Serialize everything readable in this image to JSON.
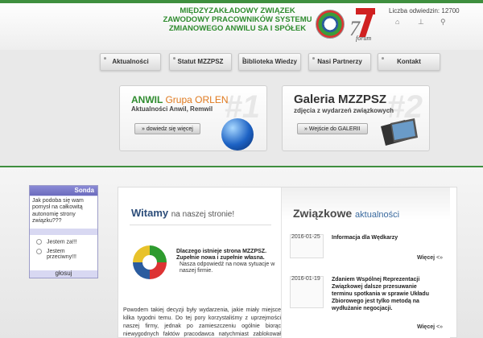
{
  "header": {
    "org_name": "MIĘDZYZAKŁADOWY ZWIĄZEK ZAWODOWY PRACOWNIKÓW SYSTEMU ZMIANOWEGO ANWILU SA I SPÓŁEK",
    "logo_text": "forum",
    "visits": "Liczba odwiedzin: 12700"
  },
  "nav": [
    "Aktualności",
    "Statut MZZPSZ",
    "Biblioteka Wiedzy",
    "Nasi Partnerzy",
    "Kontakt"
  ],
  "banner1": {
    "title_part1": "ANWIL",
    "title_part2": "Grupa ORLEN",
    "subtitle": "Aktualności Anwil, Remwil",
    "button": "» dowiedz się więcej",
    "watermark": "#1"
  },
  "banner2": {
    "title": "Galeria MZZPSZ",
    "subtitle": "zdjęcia z wydarzeń związkowych",
    "button": "» Wejście do GALERII",
    "watermark": "#2"
  },
  "sonda": {
    "title": "Sonda",
    "question": "Jak podoba się wam pomysł na całkowitą autonomię strony związku???",
    "options": [
      "Jestem za!!!",
      "Jestem przeciwny!!!"
    ],
    "vote": "głosuj"
  },
  "welcome": {
    "title_bold": "Witamy",
    "title_rest": "na naszej stronie!",
    "why_title": "Dlaczego istnieje strona MZZPSZ. Zupełnie nowa i zupełnie własna.",
    "why_text": "Nasza odpowiedź na nowa sytuacje w naszej firmie.",
    "body": "Powodem takiej decyzji były wydarzenia, jakie miały miejsce kilka tygodni temu. Do tej pory korzystaliśmy z uprzejmości naszej firmy, jednak po zamieszczeniu ogólnie biorąc niewygodnych faktów pracodawca natychmiast zablokował treści zawarte na stronie."
  },
  "news": {
    "title_bold": "Związkowe",
    "title_rest": "aktualności",
    "items": [
      {
        "date": "2016-01-25",
        "title": "Informacja dla Wędkarzy",
        "more": "Więcej",
        "more_arrow": "<»"
      },
      {
        "date": "2016-01-19",
        "title": "Zdaniem Wspólnej Reprezentacji Związkowej dalsze przesuwanie terminu spotkania w sprawie Układu Zbiorowego jest tylko metodą na wydłużanie negocjacji.",
        "more": "Więcej",
        "more_arrow": "<»"
      }
    ]
  }
}
